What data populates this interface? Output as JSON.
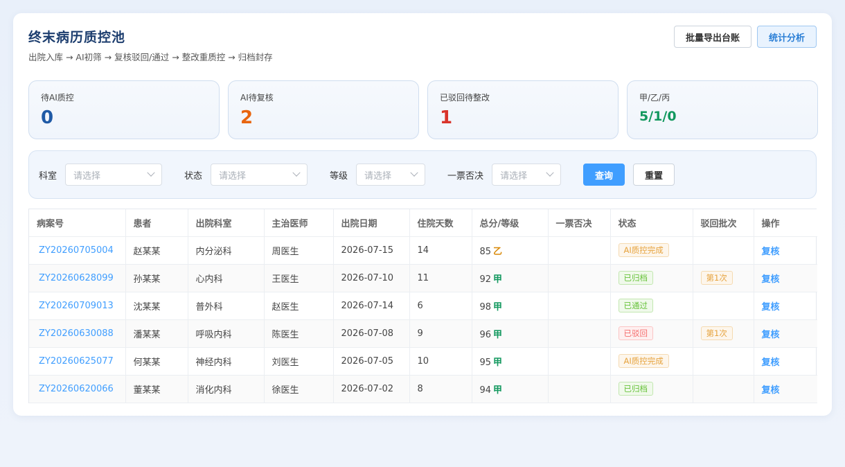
{
  "header": {
    "title": "终末病历质控池",
    "flow": "出院入库 → AI初筛 → 复核驳回/通过 → 整改重质控 → 归档封存",
    "export_label": "批量导出台账",
    "stats_label": "统计分析"
  },
  "stats": [
    {
      "label": "待AI质控",
      "value": "0",
      "color": "#1f5aa6"
    },
    {
      "label": "AI待复核",
      "value": "2",
      "color": "#e8650f"
    },
    {
      "label": "已驳回待整改",
      "value": "1",
      "color": "#d9342b"
    },
    {
      "label": "甲/乙/丙",
      "value": "5/1/0",
      "color": "#12985e"
    }
  ],
  "filters": {
    "dept_label": "科室",
    "status_label": "状态",
    "grade_label": "等级",
    "veto_label": "一票否决",
    "placeholder": "请选择",
    "search_label": "查询",
    "reset_label": "重置"
  },
  "table": {
    "columns": [
      "病案号",
      "患者",
      "出院科室",
      "主治医师",
      "出院日期",
      "住院天数",
      "总分/等级",
      "一票否决",
      "状态",
      "驳回批次",
      "操作"
    ],
    "rows": [
      {
        "id": "ZY20260705004",
        "patient": "赵某某",
        "dept": "内分泌科",
        "doctor": "周医生",
        "date": "2026-07-15",
        "days": "14",
        "score": "85",
        "grade": "乙",
        "veto": "",
        "status": "AI质控完成",
        "batch": "",
        "action": "复核"
      },
      {
        "id": "ZY20260628099",
        "patient": "孙某某",
        "dept": "心内科",
        "doctor": "王医生",
        "date": "2026-07-10",
        "days": "11",
        "score": "92",
        "grade": "甲",
        "veto": "",
        "status": "已归档",
        "batch": "第1次",
        "action": "复核"
      },
      {
        "id": "ZY20260709013",
        "patient": "沈某某",
        "dept": "普外科",
        "doctor": "赵医生",
        "date": "2026-07-14",
        "days": "6",
        "score": "98",
        "grade": "甲",
        "veto": "",
        "status": "已通过",
        "batch": "",
        "action": "复核"
      },
      {
        "id": "ZY20260630088",
        "patient": "潘某某",
        "dept": "呼吸内科",
        "doctor": "陈医生",
        "date": "2026-07-08",
        "days": "9",
        "score": "96",
        "grade": "甲",
        "veto": "",
        "status": "已驳回",
        "batch": "第1次",
        "action": "复核"
      },
      {
        "id": "ZY20260625077",
        "patient": "何某某",
        "dept": "神经内科",
        "doctor": "刘医生",
        "date": "2026-07-05",
        "days": "10",
        "score": "95",
        "grade": "甲",
        "veto": "",
        "status": "AI质控完成",
        "batch": "",
        "action": "复核"
      },
      {
        "id": "ZY20260620066",
        "patient": "董某某",
        "dept": "消化内科",
        "doctor": "徐医生",
        "date": "2026-07-02",
        "days": "8",
        "score": "94",
        "grade": "甲",
        "veto": "",
        "status": "已归档",
        "batch": "",
        "action": "复核"
      }
    ]
  },
  "colors": {
    "grade_a": "#12985e",
    "grade_b": "#d98a0b",
    "link": "#409eff",
    "primary": "#409eff"
  }
}
